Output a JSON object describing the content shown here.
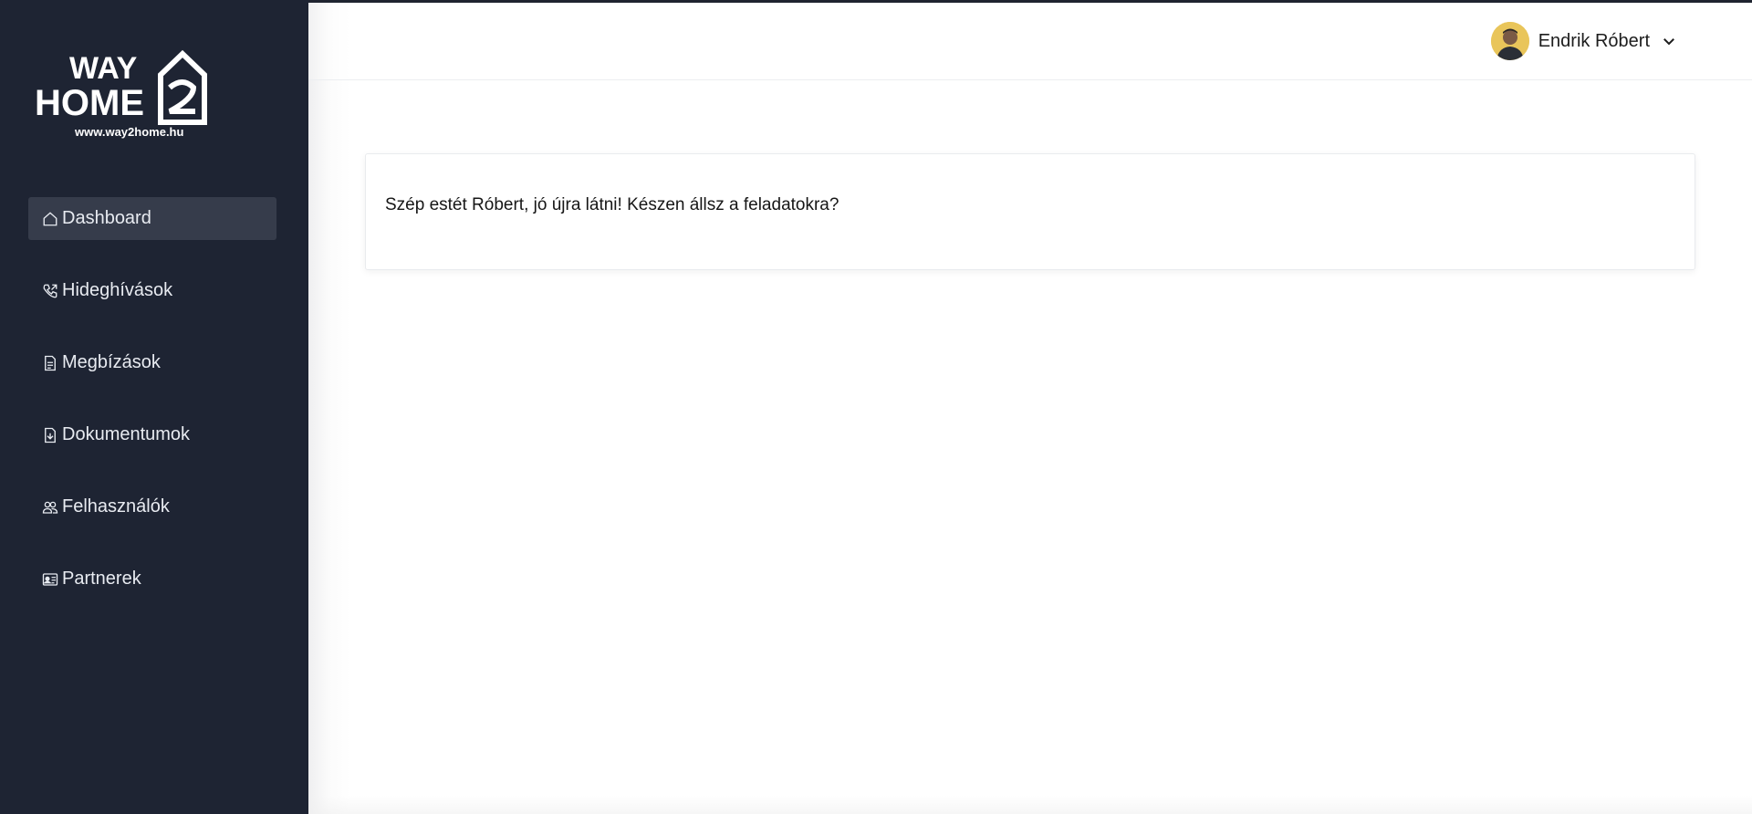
{
  "brand": {
    "line1": "WAY",
    "line2": "HOME",
    "url": "www.way2home.hu"
  },
  "sidebar": {
    "items": [
      {
        "label": "Dashboard",
        "icon": "home-icon",
        "active": true
      },
      {
        "label": "Hideghívások",
        "icon": "phone-icon",
        "active": false
      },
      {
        "label": "Megbízások",
        "icon": "document-icon",
        "active": false
      },
      {
        "label": "Dokumentumok",
        "icon": "file-download-icon",
        "active": false
      },
      {
        "label": "Felhasználók",
        "icon": "users-icon",
        "active": false
      },
      {
        "label": "Partnerek",
        "icon": "id-card-icon",
        "active": false
      }
    ]
  },
  "header": {
    "user_name": "Endrik Róbert",
    "avatar_icon": "user-avatar",
    "dropdown_icon": "chevron-down-icon"
  },
  "main": {
    "welcome_text": "Szép estét Róbert, jó újra látni! Készen állsz a feladatokra?"
  },
  "colors": {
    "sidebar_bg": "#1e2433",
    "active_item_bg": "#363c4b",
    "page_bg": "#ffffff"
  }
}
